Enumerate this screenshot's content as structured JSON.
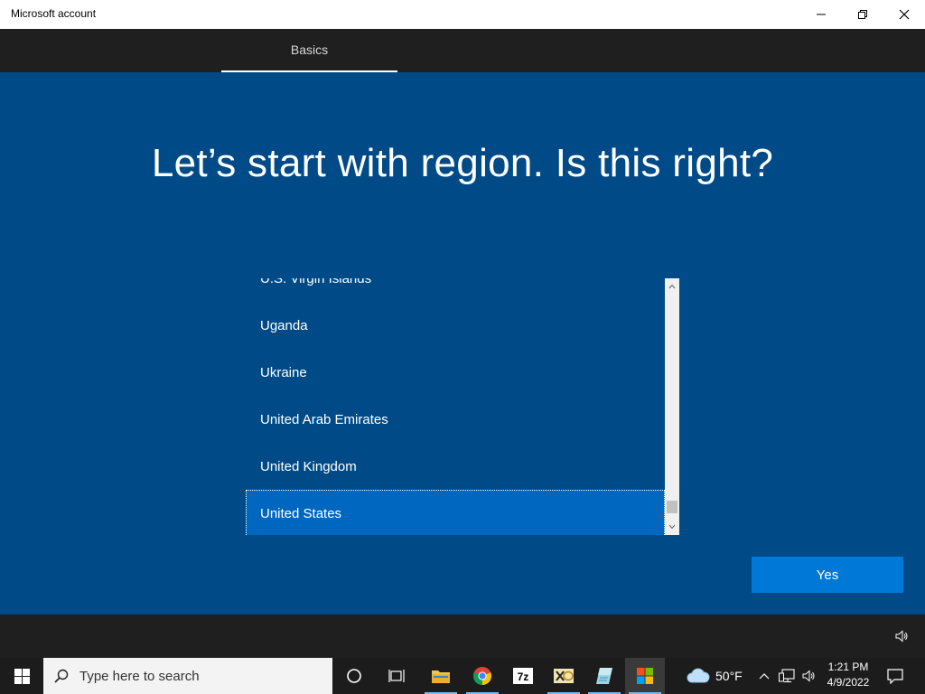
{
  "window": {
    "title": "Microsoft account",
    "minimize_icon": "minimize-icon",
    "restore_icon": "restore-icon",
    "close_icon": "close-icon"
  },
  "header": {
    "tabs": [
      {
        "label": "Basics",
        "active": true
      }
    ]
  },
  "main": {
    "heading": "Let’s start with region. Is this right?",
    "regions": [
      {
        "label": "U.S. Virgin Islands",
        "selected": false
      },
      {
        "label": "Uganda",
        "selected": false
      },
      {
        "label": "Ukraine",
        "selected": false
      },
      {
        "label": "United Arab Emirates",
        "selected": false
      },
      {
        "label": "United Kingdom",
        "selected": false
      },
      {
        "label": "United States",
        "selected": true
      }
    ],
    "confirm_button": "Yes"
  },
  "footer": {
    "icon": "volume-icon"
  },
  "taskbar": {
    "search_placeholder": "Type here to search",
    "pinned_apps": [
      "cortana",
      "task-view",
      "file-explorer",
      "chrome",
      "7-zip",
      "xml-editor",
      "notepad-app",
      "microsoft-store"
    ],
    "weather": {
      "temp": "50°F",
      "icon": "cloud-icon"
    },
    "time": "1:21 PM",
    "date": "4/9/2022"
  },
  "colors": {
    "background": "#004b87",
    "selected_item": "#0067c0",
    "accent_button": "#0078d7",
    "dark_bar": "#1f1f1f"
  }
}
